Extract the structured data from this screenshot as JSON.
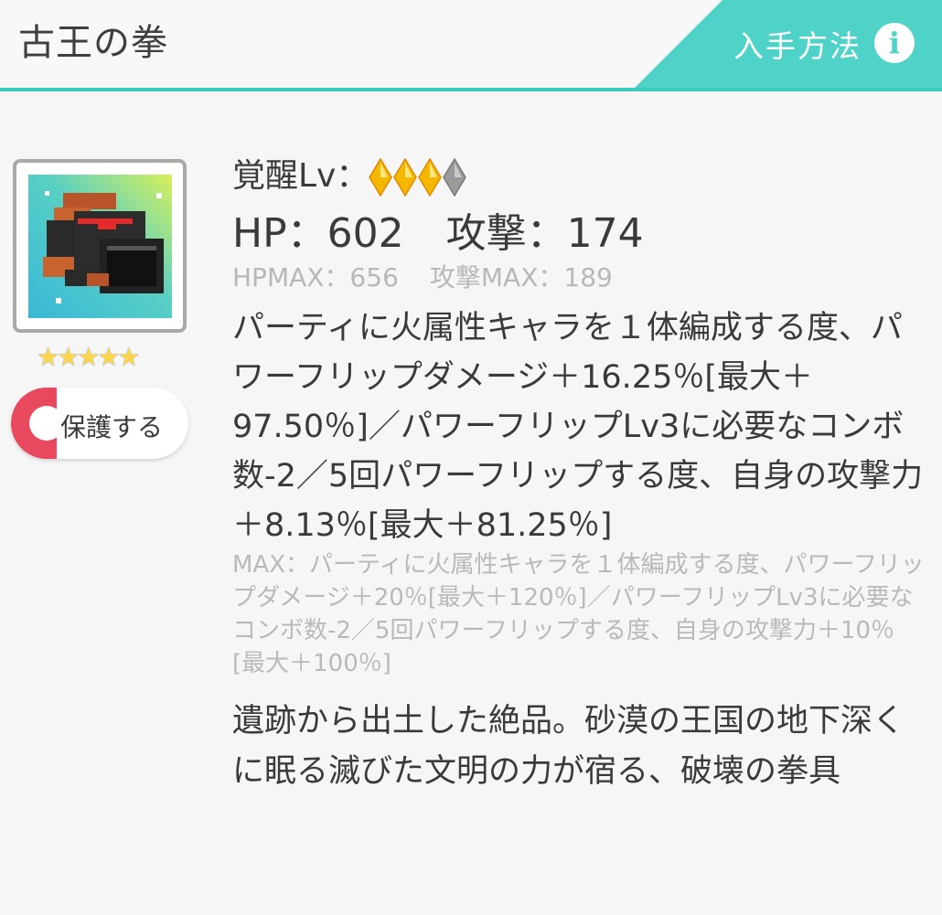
{
  "header": {
    "title": "古王の拳",
    "acquire_label": "入手方法",
    "info_icon": "info-icon"
  },
  "item": {
    "rarity_stars": "★★★★★",
    "protect_label": "保護する"
  },
  "stats": {
    "awaken_label": "覚醒Lv：",
    "awaken_level": 3,
    "awaken_max": 4,
    "hp": "HP：602",
    "attack": "攻撃：174",
    "hp_max": "HPMAX：656",
    "attack_max": "攻撃MAX：189"
  },
  "skill": {
    "text": "パーティに火属性キャラを１体編成する度、パワーフリップダメージ＋16.25％[最大＋97.50％]／パワーフリップLv3に必要なコンボ数-2／5回パワーフリップする度、自身の攻撃力＋8.13％[最大＋81.25％]",
    "max_text": "MAX：パーティに火属性キャラを１体編成する度、パワーフリップダメージ＋20％[最大＋120％]／パワーフリップLv3に必要なコンボ数-2／5回パワーフリップする度、自身の攻撃力＋10％[最大＋100％]"
  },
  "description": "遺跡から出土した絶品。砂漠の王国の地下深くに眠る滅びた文明の力が宿る、破壊の拳具",
  "colors": {
    "accent": "#4fd3c8",
    "header_border": "#3cc9c0",
    "protect_red": "#e9495f",
    "gem_gold": "#f5b800",
    "gem_gray": "#9a9a9a"
  }
}
